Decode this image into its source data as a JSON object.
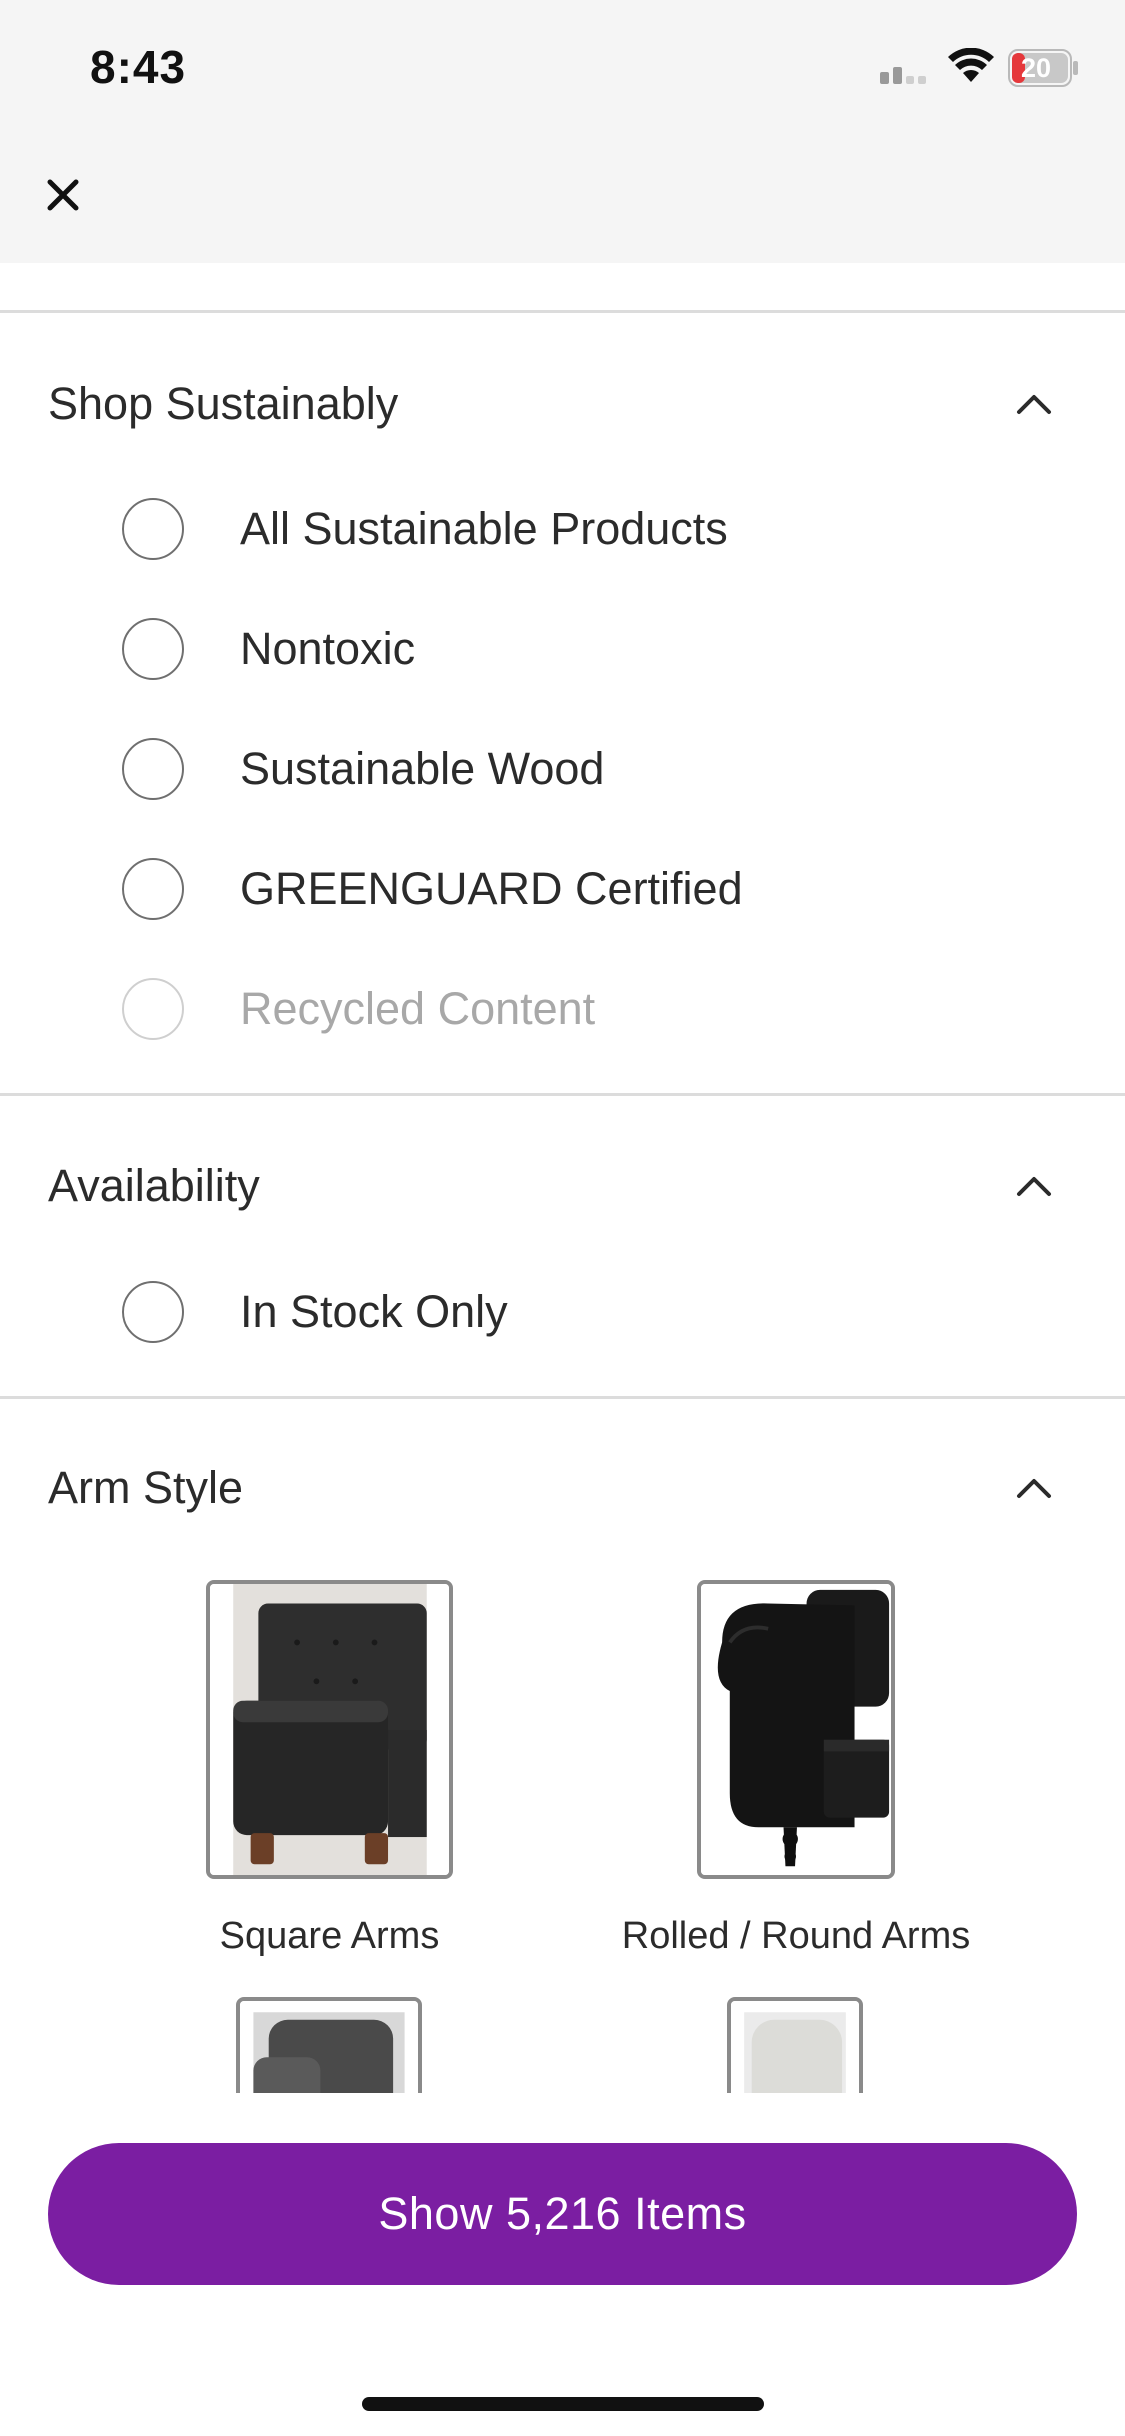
{
  "status_bar": {
    "time": "8:43",
    "battery_level": "20",
    "battery_color": "#e5383b"
  },
  "header": {
    "close_icon": "close-icon"
  },
  "sections": {
    "sustainably": {
      "title": "Shop Sustainably",
      "options": [
        {
          "label": "All Sustainable Products",
          "selected": false
        },
        {
          "label": "Nontoxic",
          "selected": false
        },
        {
          "label": "Sustainable Wood",
          "selected": false
        },
        {
          "label": "GREENGUARD Certified",
          "selected": false
        },
        {
          "label": "Recycled Content",
          "selected": false
        }
      ]
    },
    "availability": {
      "title": "Availability",
      "options": [
        {
          "label": "In Stock Only",
          "selected": false
        }
      ]
    },
    "arm_style": {
      "title": "Arm Style",
      "tiles": [
        {
          "label": "Square Arms"
        },
        {
          "label": "Rolled / Round Arms"
        },
        {
          "label": ""
        },
        {
          "label": ""
        }
      ]
    }
  },
  "footer": {
    "show_button_label": "Show 5,216 Items",
    "accent_color": "#7b1ea2"
  }
}
